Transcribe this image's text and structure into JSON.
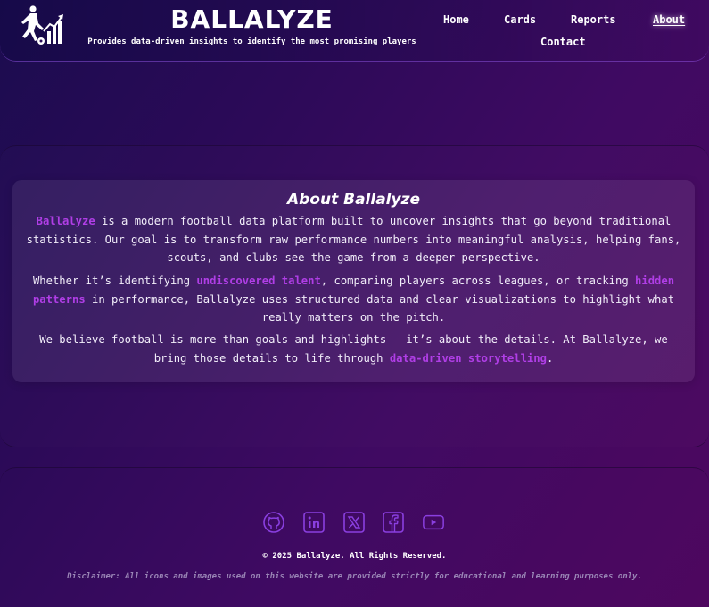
{
  "header": {
    "brand_title": "BALLALYZE",
    "brand_subtitle": "Provides data-driven insights to identify the most promising players"
  },
  "nav": {
    "items": [
      "Home",
      "Cards",
      "Reports",
      "About",
      "Contact"
    ],
    "active": "About"
  },
  "about": {
    "title": "About Ballalyze",
    "p1": {
      "highlight": "Ballalyze",
      "text": " is a modern football data platform built to uncover insights that go beyond traditional statistics. Our goal is to transform raw performance numbers into meaningful analysis, helping fans, scouts, and clubs see the game from a deeper perspective."
    },
    "p2": {
      "t1": "Whether it’s identifying ",
      "h1": "undiscovered talent",
      "t2": ", comparing players across leagues, or tracking ",
      "h2": "hidden patterns",
      "t3": " in performance, Ballalyze uses structured data and clear visualizations to highlight what really matters on the pitch."
    },
    "p3": {
      "t1": "We believe football is more than goals and highlights — it’s about the details. At Ballalyze, we bring those details to life through ",
      "h1": "data-driven storytelling",
      "t2": "."
    }
  },
  "footer": {
    "social_icons": [
      "github-icon",
      "linkedin-icon",
      "x-icon",
      "facebook-icon",
      "youtube-icon"
    ],
    "copyright": "© 2025 Ballalyze. All Rights Reserved.",
    "disclaimer": "Disclaimer: All icons and images used on this website are provided strictly for educational and learning purposes only."
  },
  "colors": {
    "highlight": "#b03ee6",
    "icon_stroke": "#8a3fe0",
    "background_start": "#1b0c4f",
    "background_end": "#4e075f"
  }
}
